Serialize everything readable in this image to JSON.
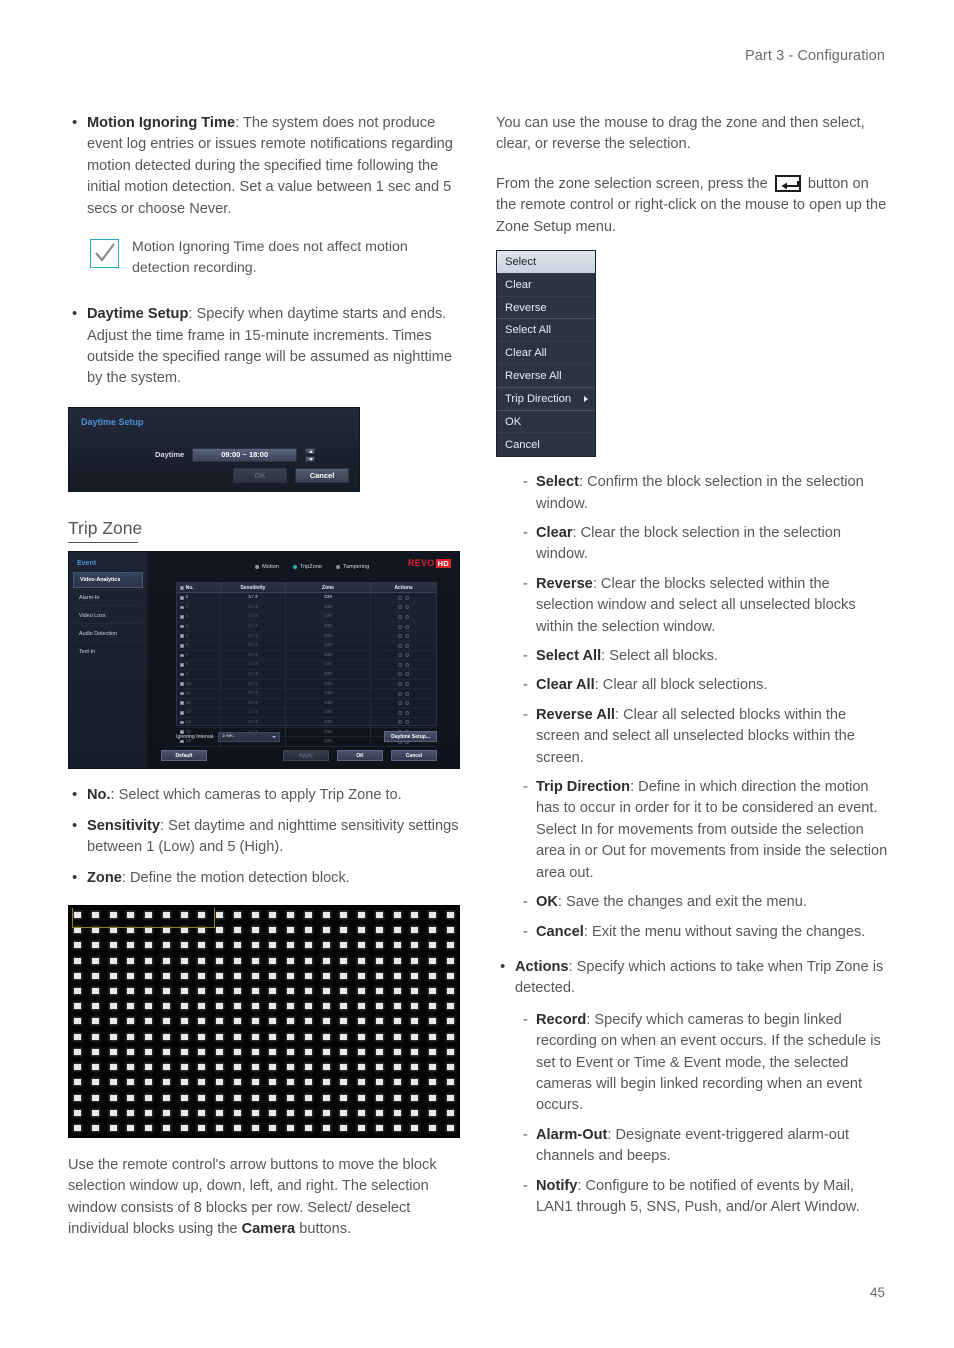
{
  "header": {
    "title": "Part 3 - Configuration"
  },
  "footer": {
    "page_number": "45"
  },
  "left_column": {
    "motion_ignoring": {
      "term": "Motion Ignoring Time",
      "text": ": The system does not produce event log entries or issues remote notifications regarding motion detected during the specified time following the initial motion detection. Set a value between 1 sec and 5 secs or choose Never."
    },
    "note": {
      "icon": "check-icon",
      "text": "Motion Ignoring Time does not affect motion detection recording.",
      "border_color": "#2aa8c4"
    },
    "daytime_setup_bullet": {
      "term": "Daytime Setup",
      "text": ": Specify when daytime starts and ends. Adjust the time frame in 15-minute increments. Times outside the specified range will be assumed as nighttime by the system."
    },
    "daytime_dialog": {
      "title": "Daytime Setup",
      "field_label": "Daytime",
      "field_value": "09:00 ~ 18:00",
      "ok_label": "OK",
      "cancel_label": "Cancel"
    },
    "section_heading": "Trip Zone",
    "dvr_screenshot": {
      "sidebar_title": "Event",
      "sidebar_items": [
        {
          "label": "Video-Analytics",
          "active": true
        },
        {
          "label": "Alarm-In",
          "active": false
        },
        {
          "label": "Video Loss",
          "active": false
        },
        {
          "label": "Audio Detection",
          "active": false
        },
        {
          "label": "Text-In",
          "active": false
        }
      ],
      "logo_text": "REVO",
      "logo_suffix": "HD",
      "tabs": [
        {
          "label": "Motion",
          "active": false
        },
        {
          "label": "TripZone",
          "active": true
        },
        {
          "label": "Tampering",
          "active": false
        }
      ],
      "table": {
        "headers": [
          "No.",
          "Sensitivity",
          "Zone",
          "Actions"
        ],
        "rows": [
          {
            "no": "1",
            "sensitivity": "3 / 3",
            "zone": "336",
            "actions": ""
          },
          {
            "no": "2",
            "sensitivity": "3 / 3",
            "zone": "336",
            "actions": ""
          },
          {
            "no": "3",
            "sensitivity": "3 / 3",
            "zone": "336",
            "actions": ""
          },
          {
            "no": "4",
            "sensitivity": "3 / 3",
            "zone": "336",
            "actions": ""
          },
          {
            "no": "5",
            "sensitivity": "3 / 3",
            "zone": "336",
            "actions": ""
          },
          {
            "no": "6",
            "sensitivity": "3 / 3",
            "zone": "336",
            "actions": ""
          },
          {
            "no": "7",
            "sensitivity": "3 / 3",
            "zone": "336",
            "actions": ""
          },
          {
            "no": "8",
            "sensitivity": "3 / 3",
            "zone": "336",
            "actions": ""
          },
          {
            "no": "9",
            "sensitivity": "3 / 3",
            "zone": "336",
            "actions": ""
          },
          {
            "no": "10",
            "sensitivity": "3 / 3",
            "zone": "336",
            "actions": ""
          },
          {
            "no": "11",
            "sensitivity": "3 / 3",
            "zone": "336",
            "actions": ""
          },
          {
            "no": "12",
            "sensitivity": "3 / 3",
            "zone": "336",
            "actions": ""
          },
          {
            "no": "13",
            "sensitivity": "3 / 3",
            "zone": "336",
            "actions": ""
          },
          {
            "no": "14",
            "sensitivity": "3 / 3",
            "zone": "336",
            "actions": ""
          },
          {
            "no": "15",
            "sensitivity": "3 / 3",
            "zone": "336",
            "actions": ""
          },
          {
            "no": "16",
            "sensitivity": "3 / 3",
            "zone": "336",
            "actions": ""
          }
        ]
      },
      "ignoring_interval_label": "Ignoring Interval",
      "ignoring_interval_value": "2 sec.",
      "daytime_setup_button": "Daytime Setup...",
      "default_button": "Default",
      "apply_button": "Apply",
      "ok_button": "OK",
      "cancel_button": "Cancel"
    },
    "bullets": [
      {
        "term": "No.",
        "text": ": Select which cameras to apply Trip Zone to."
      },
      {
        "term": "Sensitivity",
        "text": ": Set daytime and nighttime sensitivity settings between 1 (Low) and 5 (High)."
      },
      {
        "term": "Zone",
        "text": ": Define the motion detection block."
      }
    ],
    "block_grid": {
      "columns": 22,
      "rows": 15,
      "selection_blocks_per_row": 8,
      "selection_color": "#8a8320",
      "block_color": "#e9e9e9",
      "background_color": "#050505"
    },
    "closing_paragraph_1": "Use the remote control's arrow buttons to move the block selection window up, down, left, and right. The selection window consists of 8 blocks per row. Select/ deselect individual blocks using the ",
    "closing_paragraph_bold": "Camera",
    "closing_paragraph_2": " buttons."
  },
  "right_column": {
    "intro_paragraph": "You can use the mouse to drag the zone and then select, clear, or reverse the selection.",
    "press_prefix": "From the zone selection screen, press the ",
    "key_icon": "enter-key-icon",
    "press_suffix": " button on the remote control or right-click on the mouse to open up the Zone Setup menu.",
    "zone_menu": {
      "items": [
        {
          "label": "Select",
          "selected": true,
          "submenu": false
        },
        {
          "label": "Clear",
          "selected": false,
          "submenu": false
        },
        {
          "label": "Reverse",
          "selected": false,
          "submenu": false
        },
        {
          "label": "Select All",
          "selected": false,
          "submenu": false
        },
        {
          "label": "Clear All",
          "selected": false,
          "submenu": false
        },
        {
          "label": "Reverse All",
          "selected": false,
          "submenu": false
        },
        {
          "label": "Trip Direction",
          "selected": false,
          "submenu": true
        },
        {
          "label": "OK",
          "selected": false,
          "submenu": false
        },
        {
          "label": "Cancel",
          "selected": false,
          "submenu": false
        }
      ]
    },
    "menu_descriptions": [
      {
        "term": "Select",
        "text": ": Confirm the block selection in the selection window."
      },
      {
        "term": "Clear",
        "text": ": Clear the block selection in the selection window."
      },
      {
        "term": "Reverse",
        "text": ": Clear the blocks selected within the selection window and select all unselected blocks within the selection window."
      },
      {
        "term": "Select All",
        "text": ": Select all blocks."
      },
      {
        "term": "Clear All",
        "text": ": Clear all block selections."
      },
      {
        "term": "Reverse All",
        "text": ": Clear all selected blocks within the screen and select all unselected blocks within the screen."
      },
      {
        "term": "Trip Direction",
        "text": ": Define in which direction the motion has to occur in order for it to be considered an event. Select In for movements from outside the selection area in or Out for movements from inside the selection area out."
      },
      {
        "term": "OK",
        "text": ": Save the changes and exit the menu."
      },
      {
        "term": "Cancel",
        "text": ": Exit the menu without saving the changes."
      }
    ],
    "actions_bullet": {
      "term": "Actions",
      "text": ": Specify which actions to take when Trip Zone is detected."
    },
    "actions_items": [
      {
        "term": "Record",
        "text": ": Specify which cameras to begin linked recording on when an event occurs. If the schedule is set to Event or Time & Event mode, the selected cameras will begin linked recording when an event occurs."
      },
      {
        "term": "Alarm-Out",
        "text": ": Designate event-triggered alarm-out channels and beeps."
      },
      {
        "term": "Notify",
        "text": ": Configure to be notified of events by Mail, LAN1 through 5, SNS, Push, and/or Alert Window."
      }
    ]
  }
}
